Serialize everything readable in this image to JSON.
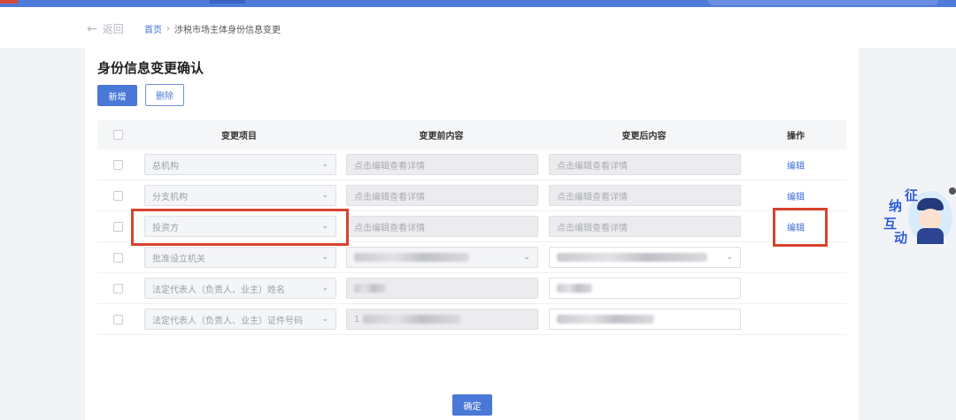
{
  "nav": {
    "back_label": "返回",
    "breadcrumb": {
      "home": "首页",
      "separator": "›",
      "current": "涉税市场主体身份信息变更"
    }
  },
  "page": {
    "title": "身份信息变更确认",
    "add_button": "新增",
    "delete_button": "删除",
    "confirm_button": "确定"
  },
  "table": {
    "headers": {
      "item": "变更项目",
      "before": "变更前内容",
      "after": "变更后内容",
      "operation": "操作"
    },
    "rows": [
      {
        "item": "总机构",
        "before": "点击编辑查看详情",
        "after": "点击编辑查看详情",
        "op": "编辑"
      },
      {
        "item": "分支机构",
        "before": "点击编辑查看详情",
        "after": "点击编辑查看详情",
        "op": "编辑"
      },
      {
        "item": "投资方",
        "before": "点击编辑查看详情",
        "after": "点击编辑查看详情",
        "op": "编辑"
      },
      {
        "item": "批准设立机关",
        "before": "",
        "after": "",
        "op": ""
      },
      {
        "item": "法定代表人（负责人、业主）姓名",
        "before": "",
        "after": "",
        "op": ""
      },
      {
        "item": "法定代表人（负责人、业主）证件号码",
        "before": "1",
        "after": "",
        "op": ""
      }
    ]
  },
  "mascot": {
    "chars": [
      "征",
      "纳",
      "互",
      "动"
    ]
  },
  "colors": {
    "primary": "#4a78d6",
    "highlight": "#d8432f",
    "link": "#3f6fd6"
  },
  "icons": {
    "back": "arrow-left-icon",
    "dropdown": "chevron-down-icon"
  }
}
